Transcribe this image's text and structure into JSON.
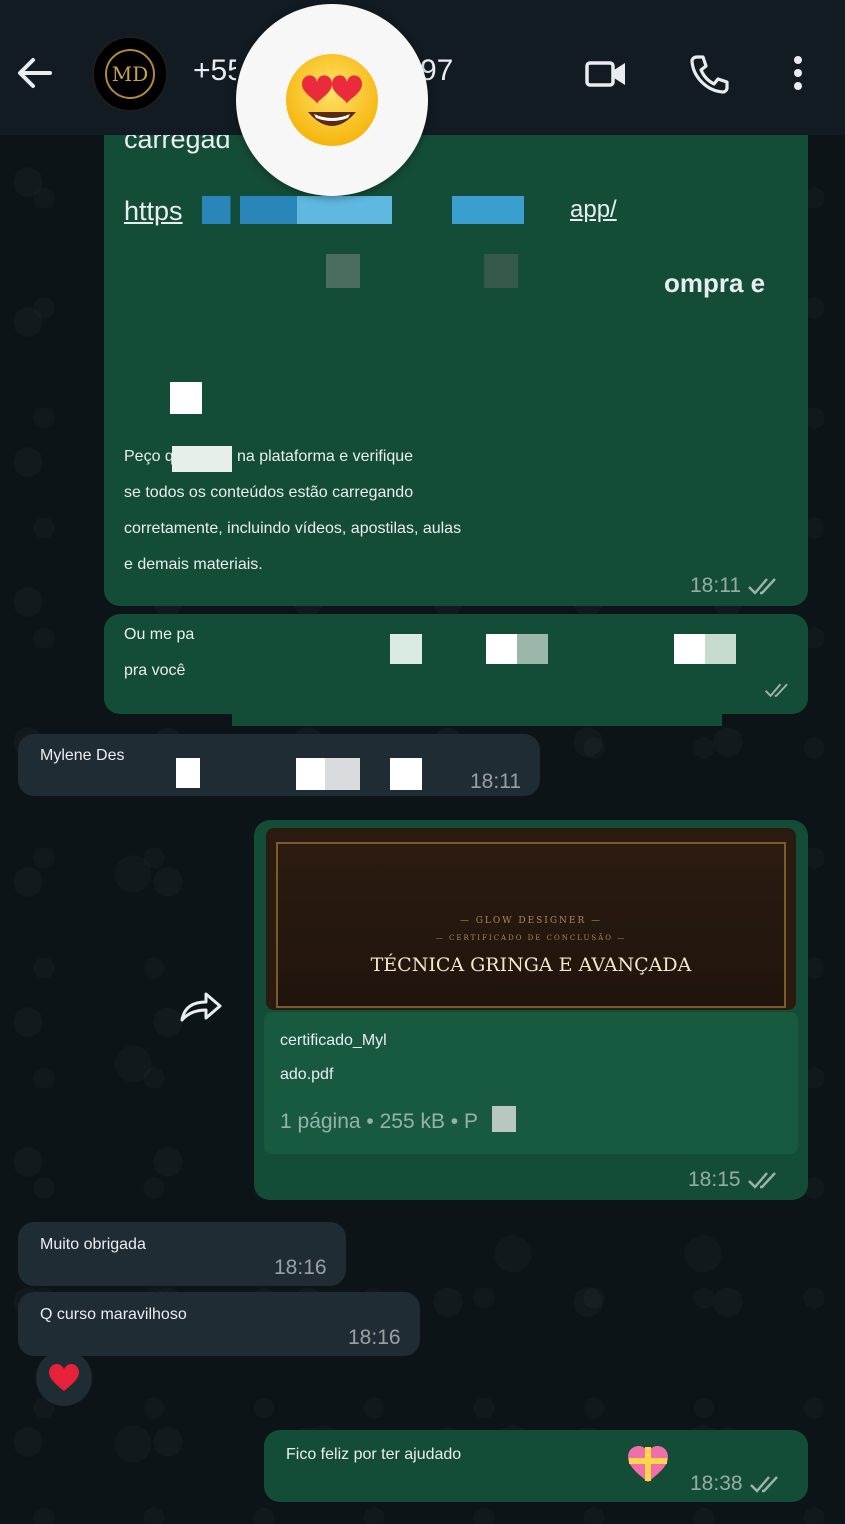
{
  "header": {
    "contact_name": "+55",
    "contact_name_tail": "97",
    "avatar_initials": "MD"
  },
  "overlay": {
    "emoji": "heart-eyes-face"
  },
  "messages": {
    "m1": {
      "line_top": "carregad",
      "link_prefix": "https",
      "link_suffix": "app/",
      "fragment": "ompra e",
      "line1": "Peço que entre na plataforma e verifique",
      "line2": "se todos os conteúdos estão carregando",
      "line3": "corretamente, incluindo vídeos, apostilas, aulas",
      "line4": "e demais materiais.",
      "time": "18:11"
    },
    "m2": {
      "line1": "Ou me pa",
      "line2": "pra você"
    },
    "m3": {
      "text": "Mylene Des",
      "time": "18:11"
    },
    "m4": {
      "pdf_brand": "— GLOW DESIGNER —",
      "pdf_subtitle": "— CERTIFICADO DE CONCLUSÃO —",
      "pdf_title": "TÉCNICA GRINGA E AVANÇADA",
      "filename_line1": "certificado_Myl",
      "filename_line2": "ado.pdf",
      "meta": "1 página • 255 kB • P",
      "time": "18:15"
    },
    "m5": {
      "text": "Muito obrigada",
      "time": "18:16"
    },
    "m6": {
      "text": "Q curso maravilhoso",
      "time": "18:16"
    },
    "m7": {
      "text": "Fico feliz por ter ajudado",
      "time": "18:38"
    }
  },
  "colors": {
    "outgoing_bubble": "#144d37",
    "incoming_bubble": "#202c33",
    "link": "#53bdeb",
    "header_bg": "#111b21"
  }
}
